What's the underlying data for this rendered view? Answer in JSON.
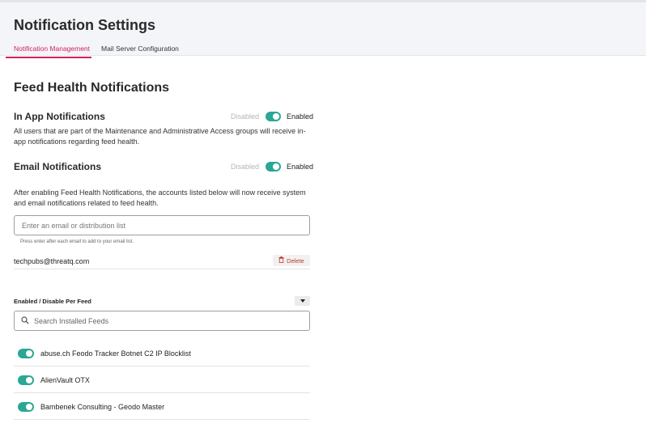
{
  "header": {
    "title": "Notification Settings",
    "tabs": [
      {
        "label": "Notification Management",
        "active": true
      },
      {
        "label": "Mail Server Configuration",
        "active": false
      }
    ],
    "accent_color": "#d6205c"
  },
  "feed_health": {
    "title": "Feed Health Notifications",
    "in_app": {
      "title": "In App Notifications",
      "disabled_label": "Disabled",
      "enabled_label": "Enabled",
      "enabled": true,
      "description": "All users that are part of the Maintenance and Administrative Access groups will receive in-app notifications regarding feed health."
    },
    "email": {
      "title": "Email Notifications",
      "disabled_label": "Disabled",
      "enabled_label": "Enabled",
      "enabled": true,
      "description": "After enabling Feed Health Notifications, the accounts listed below will now receive system and email notifications related to feed health.",
      "input_placeholder": "Enter an email or distribution list",
      "hint": "Press enter after each email to add to your email list.",
      "recipients": [
        {
          "address": "techpubs@threatq.com",
          "delete_label": "Delete"
        }
      ]
    },
    "per_feed": {
      "label": "Enabled / Disable Per Feed",
      "search_placeholder": "Search Installed Feeds",
      "feeds": [
        {
          "name": "abuse.ch Feodo Tracker Botnet C2 IP Blocklist",
          "enabled": true
        },
        {
          "name": "AlienVault OTX",
          "enabled": true
        },
        {
          "name": "Bambenek Consulting - Geodo Master",
          "enabled": true
        }
      ]
    }
  },
  "colors": {
    "toggle_on": "#2aa795",
    "delete_text": "#c0392b"
  }
}
